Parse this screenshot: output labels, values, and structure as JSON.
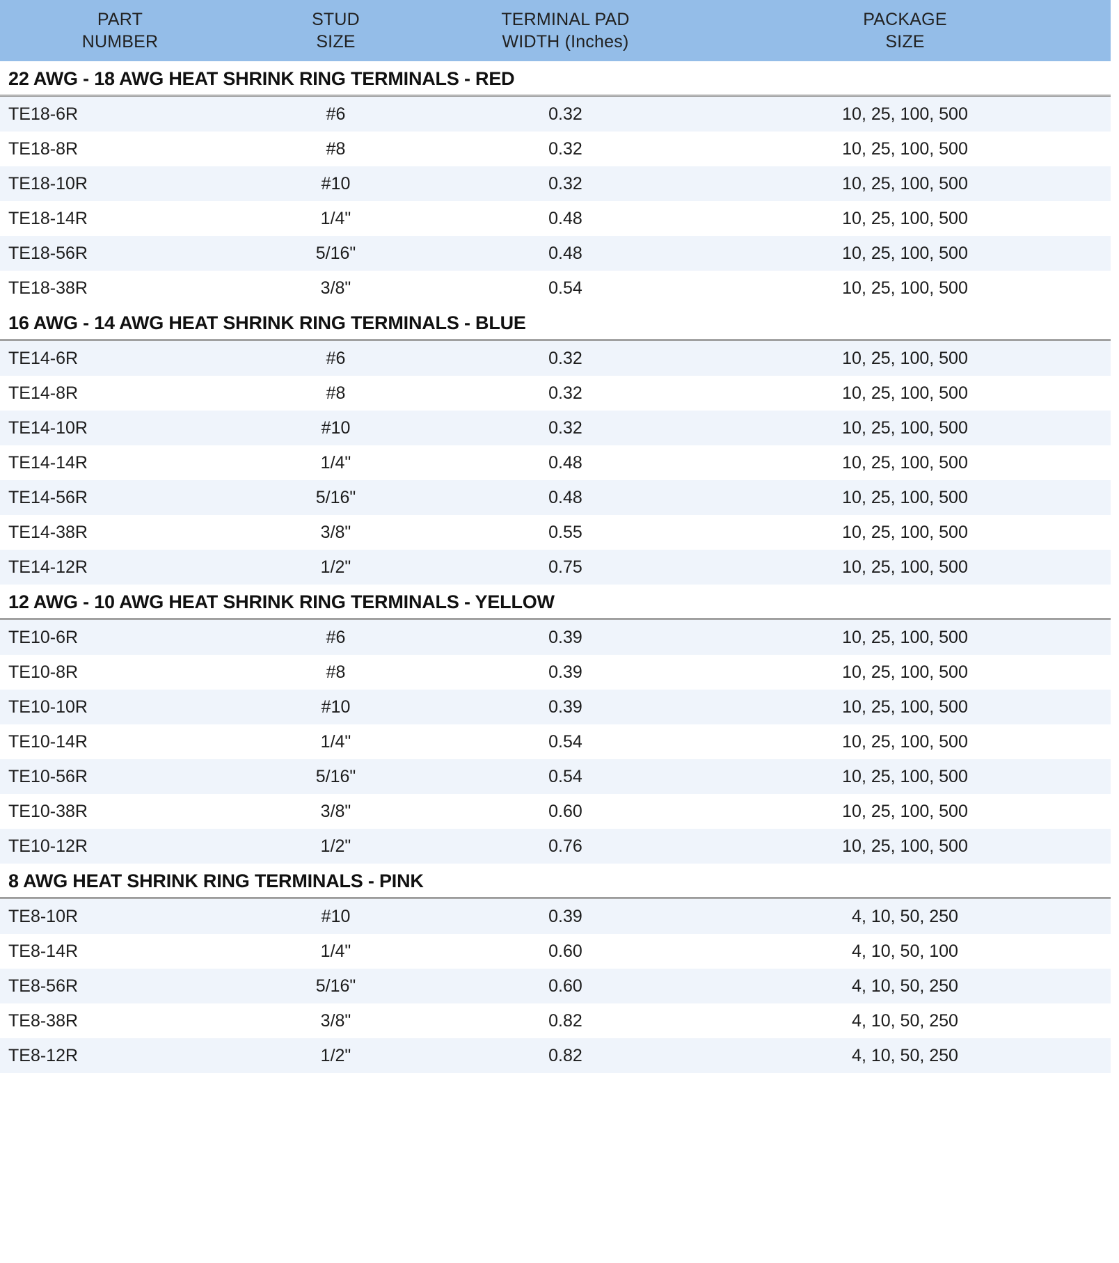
{
  "table": {
    "columns": [
      {
        "line1": "PART",
        "line2": "NUMBER"
      },
      {
        "line1": "STUD",
        "line2": "SIZE"
      },
      {
        "line1": "TERMINAL PAD",
        "line2": "WIDTH (Inches)"
      },
      {
        "line1": "PACKAGE",
        "line2": "SIZE"
      }
    ],
    "header_bg": "#94bde8",
    "row_tint_bg": "#eff4fb",
    "row_plain_bg": "#ffffff",
    "rule_color": "#8d8d8d",
    "sections": [
      {
        "title": "22 AWG - 18 AWG  HEAT SHRINK RING TERMINALS - RED",
        "color_name": "RED",
        "rows": [
          {
            "part": "TE18-6R",
            "stud": "#6",
            "width": "0.32",
            "package": "10, 25, 100, 500"
          },
          {
            "part": "TE18-8R",
            "stud": "#8",
            "width": "0.32",
            "package": "10, 25, 100, 500"
          },
          {
            "part": "TE18-10R",
            "stud": "#10",
            "width": "0.32",
            "package": "10, 25, 100, 500"
          },
          {
            "part": "TE18-14R",
            "stud": "1/4\"",
            "width": "0.48",
            "package": "10, 25, 100, 500"
          },
          {
            "part": "TE18-56R",
            "stud": "5/16\"",
            "width": "0.48",
            "package": "10, 25, 100, 500"
          },
          {
            "part": "TE18-38R",
            "stud": "3/8\"",
            "width": "0.54",
            "package": "10, 25, 100, 500"
          }
        ]
      },
      {
        "title": "16 AWG - 14 AWG  HEAT SHRINK RING TERMINALS - BLUE",
        "color_name": "BLUE",
        "rows": [
          {
            "part": "TE14-6R",
            "stud": "#6",
            "width": "0.32",
            "package": "10, 25, 100, 500"
          },
          {
            "part": "TE14-8R",
            "stud": "#8",
            "width": "0.32",
            "package": "10, 25, 100, 500"
          },
          {
            "part": "TE14-10R",
            "stud": "#10",
            "width": "0.32",
            "package": "10, 25, 100, 500"
          },
          {
            "part": "TE14-14R",
            "stud": "1/4\"",
            "width": "0.48",
            "package": "10, 25, 100, 500"
          },
          {
            "part": "TE14-56R",
            "stud": "5/16\"",
            "width": "0.48",
            "package": "10, 25, 100, 500"
          },
          {
            "part": "TE14-38R",
            "stud": "3/8\"",
            "width": "0.55",
            "package": "10, 25, 100, 500"
          },
          {
            "part": "TE14-12R",
            "stud": "1/2\"",
            "width": "0.75",
            "package": "10, 25, 100, 500"
          }
        ]
      },
      {
        "title": "12 AWG - 10 AWG  HEAT SHRINK RING TERMINALS - YELLOW",
        "color_name": "YELLOW",
        "rows": [
          {
            "part": "TE10-6R",
            "stud": "#6",
            "width": "0.39",
            "package": "10, 25, 100, 500"
          },
          {
            "part": "TE10-8R",
            "stud": "#8",
            "width": "0.39",
            "package": "10, 25, 100, 500"
          },
          {
            "part": "TE10-10R",
            "stud": "#10",
            "width": "0.39",
            "package": "10, 25, 100, 500"
          },
          {
            "part": "TE10-14R",
            "stud": "1/4\"",
            "width": "0.54",
            "package": "10, 25, 100, 500"
          },
          {
            "part": "TE10-56R",
            "stud": "5/16\"",
            "width": "0.54",
            "package": "10, 25, 100, 500"
          },
          {
            "part": "TE10-38R",
            "stud": "3/8\"",
            "width": "0.60",
            "package": "10, 25, 100, 500"
          },
          {
            "part": "TE10-12R",
            "stud": "1/2\"",
            "width": "0.76",
            "package": "10, 25, 100, 500"
          }
        ]
      },
      {
        "title": "8 AWG  HEAT SHRINK RING TERMINALS - PINK",
        "color_name": "PINK",
        "rows": [
          {
            "part": "TE8-10R",
            "stud": "#10",
            "width": "0.39",
            "package": "4, 10, 50, 250"
          },
          {
            "part": "TE8-14R",
            "stud": "1/4\"",
            "width": "0.60",
            "package": "4, 10, 50, 100"
          },
          {
            "part": "TE8-56R",
            "stud": "5/16\"",
            "width": "0.60",
            "package": "4, 10, 50, 250"
          },
          {
            "part": "TE8-38R",
            "stud": "3/8\"",
            "width": "0.82",
            "package": "4, 10, 50, 250"
          },
          {
            "part": "TE8-12R",
            "stud": "1/2\"",
            "width": "0.82",
            "package": "4, 10, 50, 250"
          }
        ]
      }
    ]
  }
}
